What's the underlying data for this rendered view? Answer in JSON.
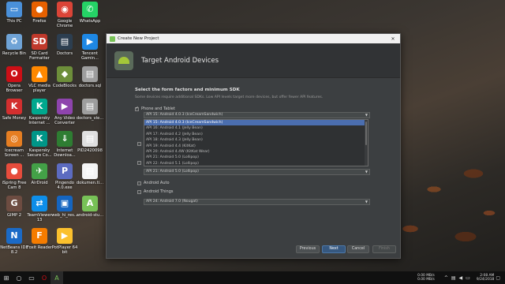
{
  "desktop_icons": [
    {
      "label": "This PC",
      "color": "#4a90d9",
      "glyph": "▭"
    },
    {
      "label": "Firefox",
      "color": "#e66000",
      "glyph": "●"
    },
    {
      "label": "Google Chrome",
      "color": "#db4437",
      "glyph": "◉"
    },
    {
      "label": "WhatsApp",
      "color": "#25d366",
      "glyph": "✆"
    },
    {
      "label": "Recycle Bin",
      "color": "#6fa3d6",
      "glyph": "♻"
    },
    {
      "label": "SD Card Formatter",
      "color": "#c0392b",
      "glyph": "SD"
    },
    {
      "label": "Doctors",
      "color": "#2c3e50",
      "glyph": "▤"
    },
    {
      "label": "Tencent Gamin...",
      "color": "#1e88e5",
      "glyph": "▶"
    },
    {
      "label": "Opera Browser",
      "color": "#cc0f16",
      "glyph": "O"
    },
    {
      "label": "VLC media player",
      "color": "#ff8800",
      "glyph": "▲"
    },
    {
      "label": "CodeBlocks",
      "color": "#6d8e3a",
      "glyph": "◆"
    },
    {
      "label": "doctors.sql",
      "color": "#9e9e9e",
      "glyph": "▤"
    },
    {
      "label": "Safe Money",
      "color": "#d32f2f",
      "glyph": "K"
    },
    {
      "label": "Kaspersky Internet ...",
      "color": "#00a88e",
      "glyph": "K"
    },
    {
      "label": "Any Video Converter",
      "color": "#8e44ad",
      "glyph": "▶"
    },
    {
      "label": "doctors_vie...",
      "color": "#9e9e9e",
      "glyph": "▤"
    },
    {
      "label": "Icecream Screen ...",
      "color": "#e67e22",
      "glyph": "◎"
    },
    {
      "label": "Kaspersky Secure Co...",
      "color": "#009688",
      "glyph": "K"
    },
    {
      "label": "Internet Downloa...",
      "color": "#2e7d32",
      "glyph": "⇓"
    },
    {
      "label": "PID2420098",
      "color": "#e0e0e0",
      "glyph": "▤"
    },
    {
      "label": "iSpring Free Cam 8",
      "color": "#e74c3c",
      "glyph": "●"
    },
    {
      "label": "AirDroid",
      "color": "#43a047",
      "glyph": "✈"
    },
    {
      "label": "Pingendo 4.0.exe",
      "color": "#5c6bc0",
      "glyph": "P"
    },
    {
      "label": "dokumen.ti...",
      "color": "#f5f5f5",
      "glyph": "▤"
    },
    {
      "label": "GIMP 2",
      "color": "#6d4c41",
      "glyph": "G"
    },
    {
      "label": "TeamViewer 13",
      "color": "#0e8ee9",
      "glyph": "⇄"
    },
    {
      "label": "web_hi_res...",
      "color": "#1565c0",
      "glyph": "▣"
    },
    {
      "label": "android-stu...",
      "color": "#78c257",
      "glyph": "A"
    },
    {
      "label": "NetBeans IDE 8.2",
      "color": "#1b6ac6",
      "glyph": "N"
    },
    {
      "label": "Foxit Reader",
      "color": "#f57c00",
      "glyph": "F"
    },
    {
      "label": "PotPlayer 64 bit",
      "color": "#fbc02d",
      "glyph": "▶"
    }
  ],
  "dialog": {
    "window_title": "Create New Project",
    "header_title": "Target Android Devices",
    "heading": "Select the form factors and minimum SDK",
    "subtext": "Some devices require additional SDKs. Low API levels target more devices, but offer fewer API features.",
    "phone_tablet_label": "Phone and Tablet",
    "phone_tablet_checked": true,
    "phone_api_selected": "API 15: Android 4.0.3 (IceCreamSandwich)",
    "dropdown_options": [
      "API 15: Android 4.0.3 (IceCreamSandwich)",
      "API 16: Android 4.1 (Jelly Bean)",
      "API 17: Android 4.2 (Jelly Bean)",
      "API 18: Android 4.3 (Jelly Bean)",
      "API 19: Android 4.4 (KitKat)",
      "API 20: Android 4.4W (KitKat Wear)",
      "API 21: Android 5.0 (Lollipop)",
      "API 22: Android 5.1 (Lollipop)"
    ],
    "lower_api_selected": "API 21: Android 5.0 (Lollipop)",
    "auto_label": "Android Auto",
    "things_label": "Android Things",
    "things_api": "API 24: Android 7.0 (Nougat)",
    "buttons": {
      "previous": "Previous",
      "next": "Next",
      "cancel": "Cancel",
      "finish": "Finish"
    }
  },
  "taskbar": {
    "net_up": "0.00 MB/s",
    "net_down": "0.00 MB/s",
    "time": "2:08 AM",
    "date": "9/24/2018"
  }
}
